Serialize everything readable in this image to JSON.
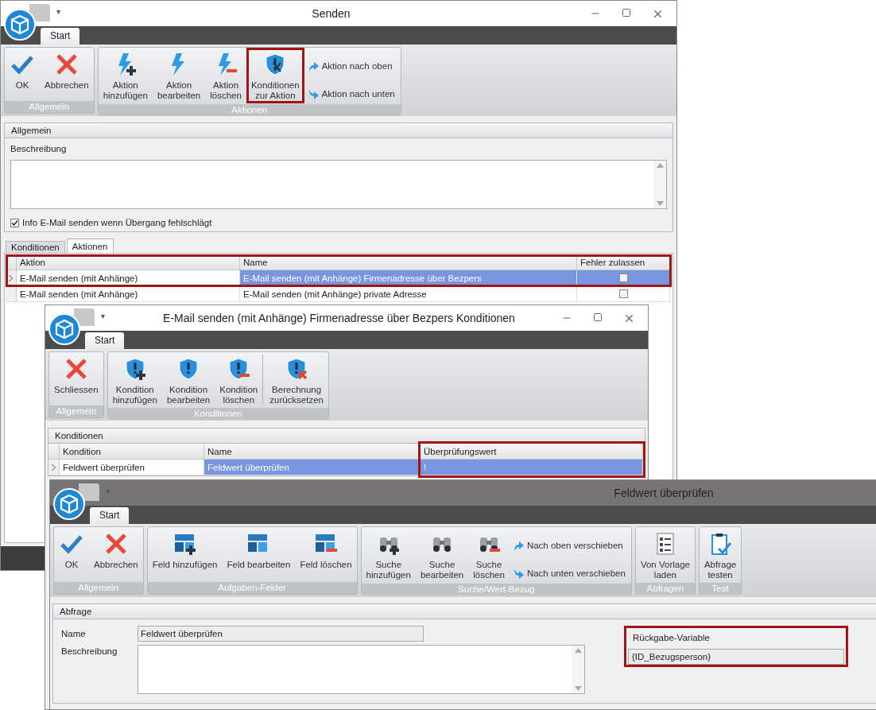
{
  "main_window": {
    "title": "Senden",
    "quick_access": "▾",
    "ribbon_tab": "Start",
    "ribbon": [
      {
        "label": "Allgemein",
        "buttons": [
          {
            "kind": "large",
            "label": "OK",
            "highlighted": false
          },
          {
            "kind": "large",
            "label": "Abbrechen",
            "highlighted": false
          }
        ]
      },
      {
        "label": "Aktionen",
        "buttons": [
          {
            "kind": "large",
            "label": "Aktion\nhinzufügen",
            "highlighted": false
          },
          {
            "kind": "large",
            "label": "Aktion\nbearbeiten",
            "highlighted": false
          },
          {
            "kind": "large",
            "label": "Aktion\nlöschen",
            "highlighted": false
          },
          {
            "kind": "large",
            "label": "Konditionen\nzur Aktion",
            "highlighted": true
          },
          {
            "kind": "small",
            "label": "Aktion nach oben",
            "highlighted": false
          },
          {
            "kind": "small",
            "label": "Aktion nach unten",
            "highlighted": false
          }
        ]
      }
    ],
    "panel": {
      "title": "Allgemein",
      "description_label": "Beschreibung",
      "checkbox": {
        "label": "Info E-Mail senden wenn Übergang fehlschlägt",
        "checked": true
      }
    },
    "tabs": [
      {
        "label": "Konditionen",
        "selected": false
      },
      {
        "label": "Aktionen",
        "selected": true
      }
    ],
    "grid": {
      "highlighted": true,
      "columns": [
        {
          "label": "Aktion",
          "kind": "text",
          "highlighted": false
        },
        {
          "label": "Name",
          "kind": "text",
          "highlighted": false
        },
        {
          "label": "Fehler zulassen",
          "kind": "checkbox",
          "highlighted": false
        }
      ],
      "rows": [
        {
          "selected": true,
          "cells": [
            {
              "text": "E-Mail senden (mit Anhänge)"
            },
            {
              "text": "E-Mail senden (mit Anhänge) Firmenadresse über Bezpers"
            },
            {
              "checked": false
            }
          ]
        },
        {
          "selected": false,
          "cells": [
            {
              "text": "E-Mail senden (mit Anhänge)"
            },
            {
              "text": "E-Mail senden (mit Anhänge) private Adresse"
            },
            {
              "checked": false
            }
          ]
        }
      ]
    }
  },
  "conditions_window": {
    "title": "E-Mail senden (mit Anhänge) Firmenadresse über Bezpers Konditionen",
    "quick_access": "▾",
    "ribbon_tab": "Start",
    "ribbon": [
      {
        "label": "Allgemein",
        "buttons": [
          {
            "kind": "large",
            "label": "Schliessen",
            "highlighted": false
          }
        ]
      },
      {
        "label": "Konditionen",
        "buttons": [
          {
            "kind": "large",
            "label": "Kondition\nhinzufügen",
            "highlighted": false
          },
          {
            "kind": "large",
            "label": "Kondition\nbearbeiten",
            "highlighted": false
          },
          {
            "kind": "large",
            "label": "Kondition\nlöschen",
            "highlighted": false
          },
          {
            "kind": "large",
            "label": "Berechnung\nzurücksetzen",
            "highlighted": false,
            "separated": true
          }
        ]
      }
    ],
    "panel_title": "Konditionen",
    "grid": {
      "columns": [
        {
          "label": "Kondition",
          "highlighted": false
        },
        {
          "label": "Name",
          "highlighted": false
        },
        {
          "label": "Überprüfungswert",
          "highlighted": true
        }
      ],
      "rows": [
        {
          "selected": true,
          "cells": [
            {
              "text": "Feldwert überprüfen"
            },
            {
              "text": "Feldwert überprüfen"
            },
            {
              "text": "!"
            }
          ]
        }
      ]
    }
  },
  "query_window": {
    "title": "Feldwert überprüfen",
    "quick_access": "▾",
    "ribbon_tab": "Start",
    "ribbon": [
      {
        "label": "Allgemein",
        "buttons": [
          {
            "kind": "large",
            "label": "OK",
            "highlighted": false
          },
          {
            "kind": "large",
            "label": "Abbrechen",
            "highlighted": false
          }
        ]
      },
      {
        "label": "Aufgaben-Felder",
        "buttons": [
          {
            "kind": "large",
            "label": "Feld hinzufügen",
            "highlighted": false
          },
          {
            "kind": "large",
            "label": "Feld bearbeiten",
            "highlighted": false
          },
          {
            "kind": "large",
            "label": "Feld löschen",
            "highlighted": false
          }
        ]
      },
      {
        "label": "Suche/Wert-Bezug",
        "buttons": [
          {
            "kind": "large",
            "label": "Suche\nhinzufügen",
            "highlighted": false
          },
          {
            "kind": "large",
            "label": "Suche\nbearbeiten",
            "highlighted": false
          },
          {
            "kind": "large",
            "label": "Suche\nlöschen",
            "highlighted": false
          },
          {
            "kind": "small",
            "label": "Nach oben verschieben",
            "highlighted": false
          },
          {
            "kind": "small",
            "label": "Nach unten verschieben",
            "highlighted": false
          }
        ]
      },
      {
        "label": "Abfragen",
        "buttons": [
          {
            "kind": "large",
            "label": "Von Vorlage\nladen",
            "highlighted": false
          }
        ]
      },
      {
        "label": "Test",
        "buttons": [
          {
            "kind": "large",
            "label": "Abfrage\ntesten",
            "highlighted": false
          }
        ]
      }
    ],
    "panel": {
      "title": "Abfrage",
      "name_label": "Name",
      "name_value": "Feldwert überprüfen",
      "description_label": "Beschreibung",
      "return_variable": {
        "label": "Rückgabe-Variable",
        "value": "{ID_Bezugsperson}",
        "highlighted": true
      }
    }
  }
}
